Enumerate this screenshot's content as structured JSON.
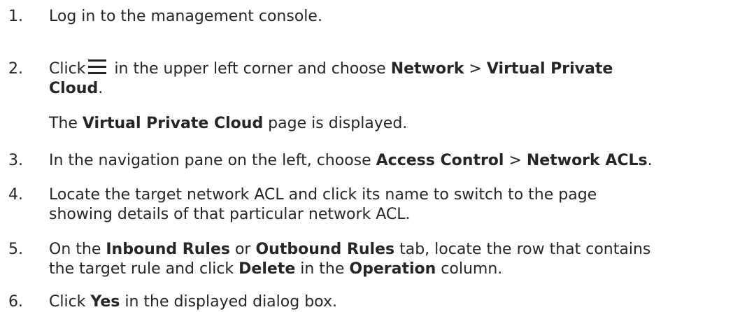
{
  "steps": [
    {
      "num": "1.",
      "text": "Log in to the management console."
    },
    {
      "num": "2.",
      "click": "Click",
      "after_icon": " in the upper left corner and choose ",
      "b1": "Network",
      "sep": " > ",
      "b2": "Virtual Private",
      "b2_cont": "Cloud",
      "end": ".",
      "result_b": "Virtual Private Cloud",
      "result_rest": " page is displayed.",
      "result_pre": "The "
    },
    {
      "num": "3.",
      "pre": "In the navigation pane on the left, choose ",
      "b1": "Access Control",
      "sep": " > ",
      "b2": "Network ACLs",
      "end": "."
    },
    {
      "num": "4.",
      "line1": "Locate the target network ACL and click its name to switch to the page",
      "line2": "showing details of that particular network ACL."
    },
    {
      "num": "5.",
      "pre": "On the ",
      "b1": "Inbound Rules",
      "mid1": " or ",
      "b2": "Outbound Rules",
      "mid2": " tab, locate the row that contains",
      "line2_pre": "the target rule and click ",
      "b3": "Delete",
      "mid3": " in the ",
      "b4": "Operation",
      "end": " column."
    },
    {
      "num": "6.",
      "pre": "Click ",
      "b1": "Yes",
      "end": " in the displayed dialog box."
    }
  ],
  "icons": {
    "menu": "hamburger-menu-icon"
  }
}
